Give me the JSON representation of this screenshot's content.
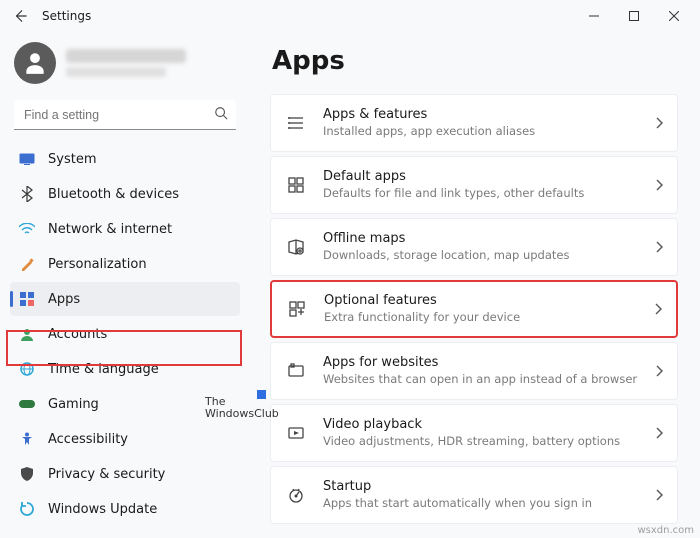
{
  "titlebar": {
    "title": "Settings"
  },
  "search": {
    "placeholder": "Find a setting"
  },
  "nav": [
    {
      "label": "System",
      "icon": "system",
      "color": "#3b6ecf"
    },
    {
      "label": "Bluetooth & devices",
      "icon": "bt",
      "color": "#3a3a3a"
    },
    {
      "label": "Network & internet",
      "icon": "net",
      "color": "#2fa8d8"
    },
    {
      "label": "Personalization",
      "icon": "perso",
      "color": "#e08a3c"
    },
    {
      "label": "Apps",
      "icon": "apps",
      "color": "#3b6ecf",
      "selected": true
    },
    {
      "label": "Accounts",
      "icon": "acct",
      "color": "#40a060"
    },
    {
      "label": "Time & language",
      "icon": "time",
      "color": "#2fa8d8"
    },
    {
      "label": "Gaming",
      "icon": "gaming",
      "color": "#2f7a3f"
    },
    {
      "label": "Accessibility",
      "icon": "a11y",
      "color": "#3b6ecf"
    },
    {
      "label": "Privacy & security",
      "icon": "priv",
      "color": "#4a4a4a"
    },
    {
      "label": "Windows Update",
      "icon": "wu",
      "color": "#2fa8d8"
    }
  ],
  "main": {
    "heading": "Apps",
    "cards": [
      {
        "title": "Apps & features",
        "sub": "Installed apps, app execution aliases"
      },
      {
        "title": "Default apps",
        "sub": "Defaults for file and link types, other defaults"
      },
      {
        "title": "Offline maps",
        "sub": "Downloads, storage location, map updates"
      },
      {
        "title": "Optional features",
        "sub": "Extra functionality for your device",
        "highlighted": true
      },
      {
        "title": "Apps for websites",
        "sub": "Websites that can open in an app instead of a browser"
      },
      {
        "title": "Video playback",
        "sub": "Video adjustments, HDR streaming, battery options"
      },
      {
        "title": "Startup",
        "sub": "Apps that start automatically when you sign in"
      }
    ]
  },
  "watermark": {
    "line1": "The",
    "line2": "WindowsClub"
  },
  "attribution": "wsxdn.com"
}
